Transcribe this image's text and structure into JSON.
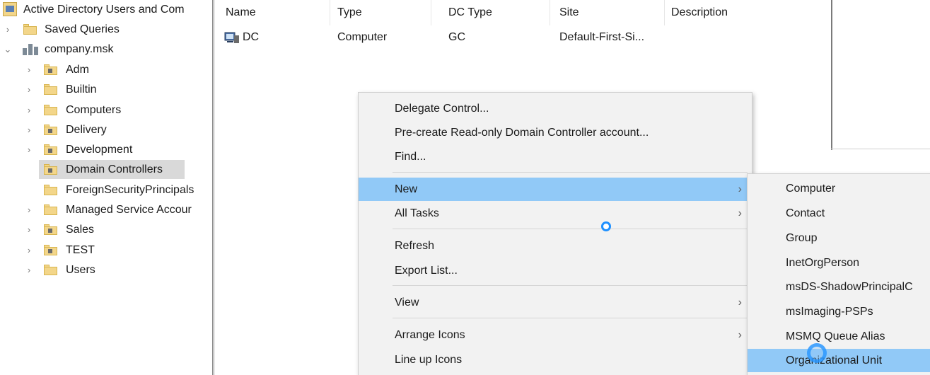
{
  "tree": {
    "root_label": "Active Directory Users and Com",
    "items": [
      {
        "label": "Saved Queries"
      },
      {
        "label": "company.msk"
      },
      {
        "label": "Adm"
      },
      {
        "label": "Builtin"
      },
      {
        "label": "Computers"
      },
      {
        "label": "Delivery"
      },
      {
        "label": "Development"
      },
      {
        "label": "Domain Controllers"
      },
      {
        "label": "ForeignSecurityPrincipals"
      },
      {
        "label": "Managed Service Accour"
      },
      {
        "label": "Sales"
      },
      {
        "label": "TEST"
      },
      {
        "label": "Users"
      }
    ]
  },
  "list": {
    "columns": [
      "Name",
      "Type",
      "DC Type",
      "Site",
      "Description"
    ],
    "rows": [
      {
        "name": "DC",
        "type": "Computer",
        "dc_type": "GC",
        "site": "Default-First-Si...",
        "description": ""
      }
    ]
  },
  "context_menu": {
    "items": [
      {
        "label": "Delegate Control..."
      },
      {
        "label": "Pre-create Read-only Domain Controller account..."
      },
      {
        "label": "Find..."
      },
      {
        "label": "New"
      },
      {
        "label": "All Tasks"
      },
      {
        "label": "Refresh"
      },
      {
        "label": "Export List..."
      },
      {
        "label": "View"
      },
      {
        "label": "Arrange Icons"
      },
      {
        "label": "Line up Icons"
      }
    ]
  },
  "submenu_new": {
    "items": [
      {
        "label": "Computer"
      },
      {
        "label": "Contact"
      },
      {
        "label": "Group"
      },
      {
        "label": "InetOrgPerson"
      },
      {
        "label": "msDS-ShadowPrincipalC"
      },
      {
        "label": "msImaging-PSPs"
      },
      {
        "label": "MSMQ Queue Alias"
      },
      {
        "label": "Organizational Unit"
      }
    ]
  },
  "colors": {
    "highlight": "#91c9f7",
    "menu_bg": "#f2f2f2",
    "selection": "#d9d9d9",
    "busy_cursor": "#1e90ff"
  }
}
